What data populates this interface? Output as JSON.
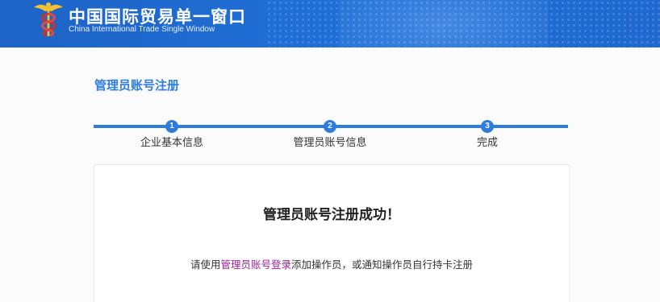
{
  "header": {
    "title_cn": "中国国际贸易单一窗口",
    "title_en": "China International Trade Single  Window",
    "logo_icon": "caduceus-icon"
  },
  "page": {
    "title": "管理员账号注册"
  },
  "steps": [
    {
      "number": "1",
      "label": "企业基本信息"
    },
    {
      "number": "2",
      "label": "管理员账号信息"
    },
    {
      "number": "3",
      "label": "完成"
    }
  ],
  "result": {
    "heading": "管理员账号注册成功！",
    "notice_prefix": "请使用",
    "notice_link": "管理员账号登录",
    "notice_suffix": "添加操作员，或通知操作员自行持卡注册"
  },
  "colors": {
    "header_blue": "#1f6fd6",
    "accent_blue": "#2e7ddc",
    "link_purple": "#a0219f"
  }
}
